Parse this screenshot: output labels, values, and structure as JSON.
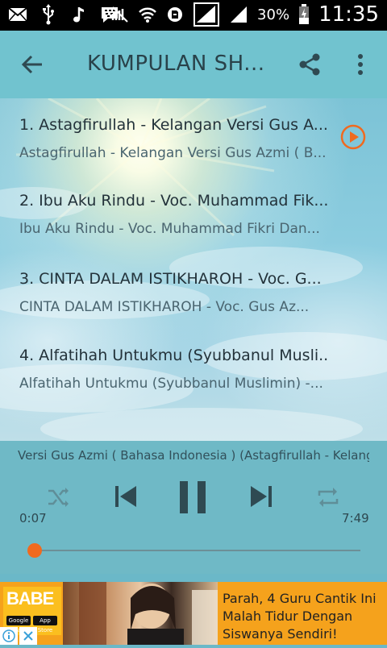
{
  "status_bar": {
    "battery": "30%",
    "time": "11:35",
    "icons": [
      "mail-icon",
      "usb-icon",
      "music-icon",
      "bbm-icon",
      "mute-icon",
      "wifi-icon",
      "data-icon",
      "signal-icon",
      "signal-icon",
      "battery-icon"
    ]
  },
  "app_bar": {
    "title": "KUMPULAN SH...",
    "icons": [
      "back-arrow-icon",
      "share-icon",
      "more-vert-icon"
    ]
  },
  "tracks": [
    {
      "title": "1. Astagfirullah - Kelangan Versi Gus A...",
      "subtitle": "Astagfirullah - Kelangan Versi Gus Azmi ( B..."
    },
    {
      "title": "2. Ibu Aku Rindu - Voc. Muhammad Fik...",
      "subtitle": "Ibu Aku Rindu - Voc. Muhammad Fikri Dan..."
    },
    {
      "title": "3. CINTA DALAM ISTIKHAROH - Voc. G...",
      "subtitle": "CINTA DALAM ISTIKHAROH - Voc. Gus Az..."
    },
    {
      "title": "4. Alfatihah Untukmu (Syubbanul Musli...",
      "subtitle": "Alfatihah Untukmu (Syubbanul Muslimin) -..."
    }
  ],
  "player": {
    "now_playing": "Versi Gus Azmi ( Bahasa Indonesia ) (Astagfirullah - Kelanga",
    "elapsed": "0:07",
    "duration": "7:49",
    "progress": 0.015,
    "accent": "#f06a1f",
    "icons": [
      "shuffle-icon",
      "previous-icon",
      "pause-icon",
      "next-icon",
      "repeat-icon"
    ]
  },
  "ad": {
    "brand": "BABE",
    "store_badges": [
      "Google Play",
      "App Store"
    ],
    "headline": "Parah, 4 Guru Cantik Ini Malah Tidur Dengan Siswanya Sendiri!",
    "icons": [
      "adchoices-icon",
      "close-icon"
    ]
  }
}
